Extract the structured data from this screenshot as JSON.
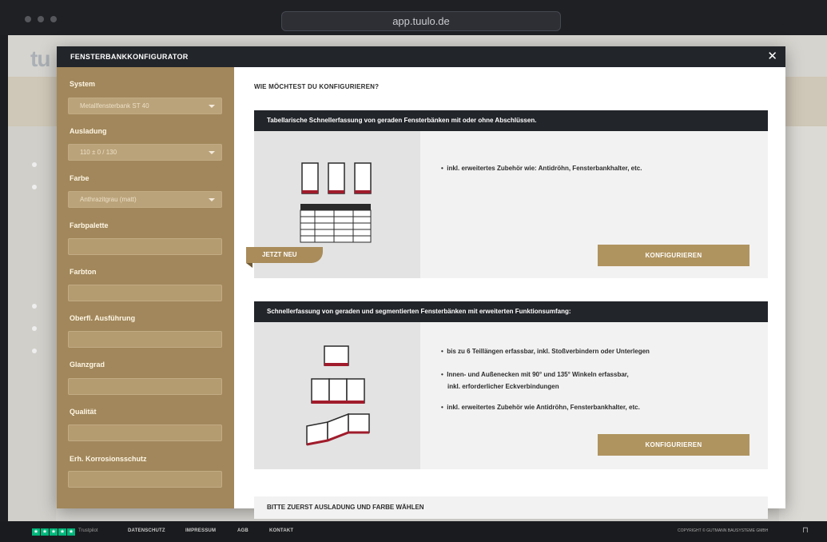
{
  "browser": {
    "url": "app.tuulo.de"
  },
  "background": {
    "logo": "tu"
  },
  "modal": {
    "title": "FENSTERBANKKONFIGURATOR",
    "close": "✕"
  },
  "sidebar": {
    "fields": [
      {
        "label": "System",
        "value": "Metallfensterbank ST 40",
        "type": "select"
      },
      {
        "label": "Ausladung",
        "value": "110 ± 0 / 130",
        "type": "select"
      },
      {
        "label": "Farbe",
        "value": "Anthrazitgrau (matt)",
        "type": "select"
      },
      {
        "label": "Farbpalette",
        "value": "",
        "type": "input"
      },
      {
        "label": "Farbton",
        "value": "",
        "type": "input"
      },
      {
        "label": "Oberfl. Ausführung",
        "value": "",
        "type": "input"
      },
      {
        "label": "Glanzgrad",
        "value": "",
        "type": "input"
      },
      {
        "label": "Qualität",
        "value": "",
        "type": "input"
      },
      {
        "label": "Erh. Korrosionsschutz",
        "value": "",
        "type": "input"
      }
    ]
  },
  "content": {
    "title": "WIE MÖCHTEST DU KONFIGURIEREN?",
    "panel1": {
      "header": "Tabellarische Schnellerfassung von geraden Fensterbänken mit oder ohne Abschlüssen.",
      "bullets": [
        "inkl. erweitertes Zubehör wie: Antidröhn, Fensterbankhalter, etc."
      ],
      "badge": "JETZT NEU",
      "button": "KONFIGURIEREN"
    },
    "panel2": {
      "header": "Schnellerfassung von geraden und segmentierten Fensterbänken mit erweiterten Funktionsumfang:",
      "bullets": [
        "bis zu 6 Teillängen erfassbar, inkl. Stoßverbindern oder Unterlegen",
        "Innen- und Außenecken mit 90° und 135° Winkeln erfassbar,",
        "inkl. erforderlicher Eckverbindungen",
        "inkl. erweitertes Zubehör wie Antidröhn, Fensterbankhalter, etc."
      ],
      "button": "KONFIGURIEREN"
    },
    "notice": "BITTE ZUERST AUSLADUNG UND FARBE WÄHLEN"
  },
  "footer": {
    "trustpilot": "Trustpilot",
    "links": [
      "DATENSCHUTZ",
      "IMPRESSUM",
      "AGB",
      "KONTAKT"
    ],
    "copyright": "COPYRIGHT © GUTMANN BAUSYSTEME GMBH"
  },
  "colors": {
    "accent": "#b0945f",
    "sidebar": "#a1875b",
    "dark": "#22252a",
    "red": "#a01c2c"
  }
}
